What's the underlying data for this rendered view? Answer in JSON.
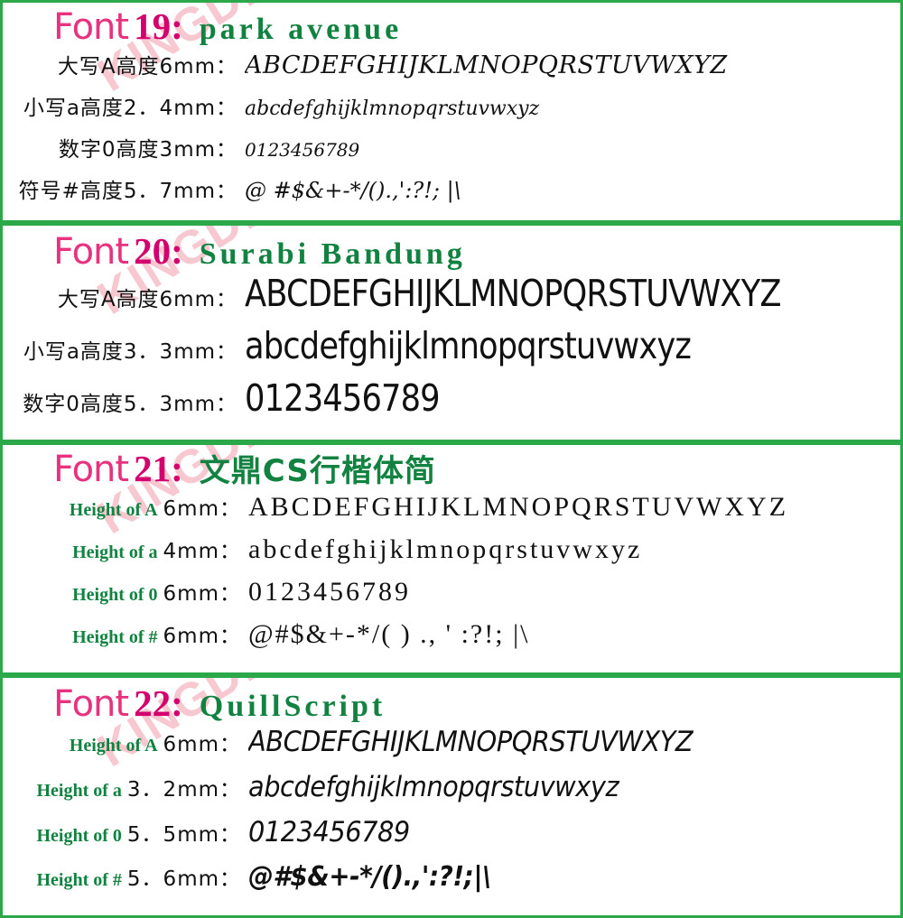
{
  "colors": {
    "border_green": "#2aa84a",
    "heading_green": "#118240",
    "font_word_pink": "#e8317f",
    "font_number_pink": "#d4006e",
    "watermark_pink": "#f6bfc8",
    "text_black": "#111111"
  },
  "watermark": {
    "text": "KINGDEN"
  },
  "common": {
    "font_word": "Font",
    "colon": ":"
  },
  "blocks": [
    {
      "number": "19",
      "font_name": "park avenue",
      "name_style": "en",
      "label_style": "cn",
      "rows": [
        {
          "label": "大写A高度6mm：",
          "label_en": "",
          "label_mm": "",
          "sample": "ABCDEFGHIJKLMNOPQRSTUVWXYZ",
          "kind": "upper"
        },
        {
          "label": "小写a高度2．4mm：",
          "label_en": "",
          "label_mm": "",
          "sample": "abcdefghijklmnopqrstuvwxyz",
          "kind": "lower"
        },
        {
          "label": "数字0高度3mm：",
          "label_en": "",
          "label_mm": "",
          "sample": "0123456789",
          "kind": "digit"
        },
        {
          "label": "符号#高度5．7mm：",
          "label_en": "",
          "label_mm": "",
          "sample": "@ #$&+-*/().,':?!; |\\",
          "kind": "symbol"
        }
      ]
    },
    {
      "number": "20",
      "font_name": "Surabi Bandung",
      "name_style": "en",
      "label_style": "cn",
      "rows": [
        {
          "label": "大写A高度6mm：",
          "label_en": "",
          "label_mm": "",
          "sample": "ABCDEFGHIJKLMNOPQRSTUVWXYZ",
          "kind": "upper"
        },
        {
          "label": "小写a高度3．3mm：",
          "label_en": "",
          "label_mm": "",
          "sample": "abcdefghijklmnopqrstuvwxyz",
          "kind": "lower"
        },
        {
          "label": "数字0高度5．3mm：",
          "label_en": "",
          "label_mm": "",
          "sample": "0123456789",
          "kind": "digit"
        }
      ]
    },
    {
      "number": "21",
      "font_name": "文鼎CS行楷体简",
      "name_style": "cn",
      "label_style": "en",
      "rows": [
        {
          "label": "",
          "label_en": "Height of A",
          "label_mm": "6mm：",
          "sample": "ABCDEFGHIJKLMNOPQRSTUVWXYZ",
          "kind": "upper"
        },
        {
          "label": "",
          "label_en": "Height of a",
          "label_mm": "4mm：",
          "sample": "abcdefghijklmnopqrstuvwxyz",
          "kind": "lower"
        },
        {
          "label": "",
          "label_en": "Height of 0",
          "label_mm": "6mm：",
          "sample": "0123456789",
          "kind": "digit"
        },
        {
          "label": "",
          "label_en": "Height of #",
          "label_mm": "6mm：",
          "sample": "@#$&+-*/( ) ., ' :?!; |\\",
          "kind": "symbol"
        }
      ]
    },
    {
      "number": "22",
      "font_name": "QuillScript",
      "name_style": "en",
      "label_style": "en",
      "rows": [
        {
          "label": "",
          "label_en": "Height of A",
          "label_mm": "6mm：",
          "sample": "ABCDEFGHIJKLMNOPQRSTUVWXYZ",
          "kind": "upper"
        },
        {
          "label": "",
          "label_en": "Height of a",
          "label_mm": "3．2mm：",
          "sample": "abcdefghijklmnopqrstuvwxyz",
          "kind": "lower"
        },
        {
          "label": "",
          "label_en": "Height of 0",
          "label_mm": "5．5mm：",
          "sample": "0123456789",
          "kind": "digit"
        },
        {
          "label": "",
          "label_en": "Height of #",
          "label_mm": "5．6mm：",
          "sample": "@#$&+-*/().,':?!;|\\",
          "kind": "symbol"
        }
      ]
    }
  ]
}
